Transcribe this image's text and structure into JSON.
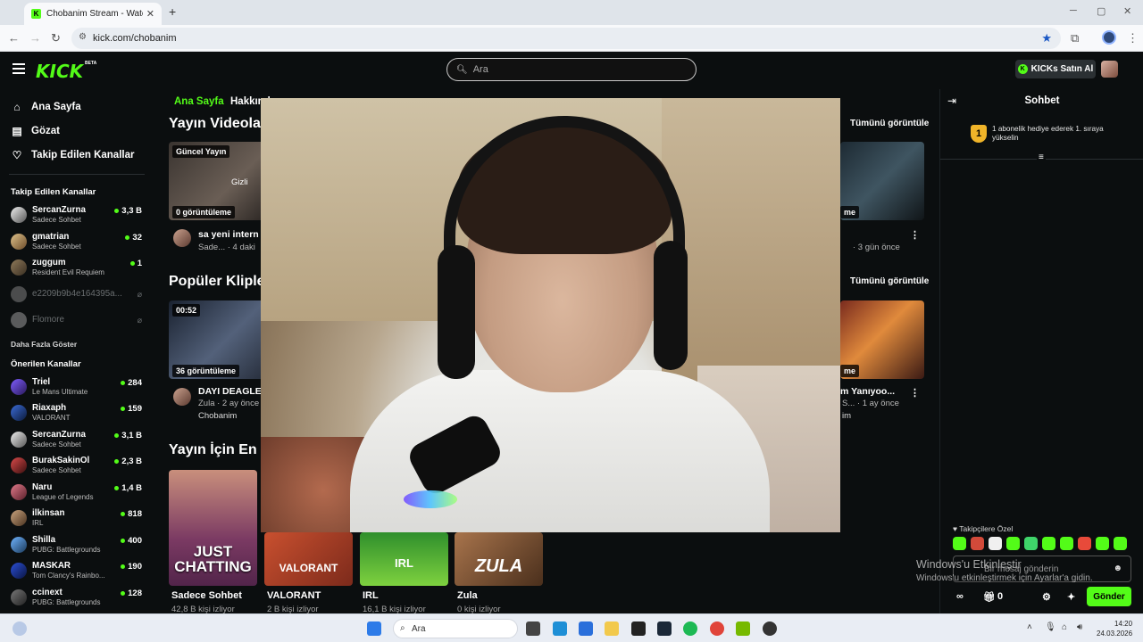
{
  "browser": {
    "tab_title": "Chobanim Stream - Watch Live",
    "tab_favicon": "K",
    "new_tab": "+",
    "url": "kick.com/chobanim"
  },
  "header": {
    "logo": "KICK",
    "beta": "BETA",
    "search_placeholder": "Ara",
    "kicks_button": "KICKs Satın Al",
    "accent_color": "#53fc18"
  },
  "sidebar": {
    "nav": [
      {
        "label": "Ana Sayfa",
        "icon": "home-icon"
      },
      {
        "label": "Gözat",
        "icon": "browse-icon"
      },
      {
        "label": "Takip Edilen Kanallar",
        "icon": "heart-icon"
      }
    ],
    "followed_title": "Takip Edilen Kanallar",
    "followed": [
      {
        "name": "SercanZurna",
        "category": "Sadece Sohbet",
        "viewers": "3,3 B"
      },
      {
        "name": "gmatrian",
        "category": "Sadece Sohbet",
        "viewers": "32"
      },
      {
        "name": "zuggum",
        "category": "Resident Evil Requiem",
        "viewers": "1"
      },
      {
        "name": "e2209b9b4e164395a...",
        "category": "",
        "viewers": ""
      },
      {
        "name": "Flomore",
        "category": "",
        "viewers": ""
      }
    ],
    "show_more": "Daha Fazla Göster",
    "recommended_title": "Önerilen Kanallar",
    "recommended": [
      {
        "name": "Triel",
        "category": "Le Mans Ultimate",
        "viewers": "284"
      },
      {
        "name": "Riaxaph",
        "category": "VALORANT",
        "viewers": "159"
      },
      {
        "name": "SercanZurna",
        "category": "Sadece Sohbet",
        "viewers": "3,1 B"
      },
      {
        "name": "BurakSakinOl",
        "category": "Sadece Sohbet",
        "viewers": "2,3 B"
      },
      {
        "name": "Naru",
        "category": "League of Legends",
        "viewers": "1,4 B"
      },
      {
        "name": "ilkinsan",
        "category": "IRL",
        "viewers": "818"
      },
      {
        "name": "Shilla",
        "category": "PUBG: Battlegrounds",
        "viewers": "400"
      },
      {
        "name": "MASKAR",
        "category": "Tom Clancy's Rainbo...",
        "viewers": "190"
      },
      {
        "name": "ccinext",
        "category": "PUBG: Battlegrounds",
        "viewers": "128"
      }
    ]
  },
  "main": {
    "tabs": [
      "Ana Sayfa",
      "Hakkında"
    ],
    "videos_title": "Yayın Videola",
    "see_all": "Tümünü görüntüle",
    "video1": {
      "badge": "Güncel Yayın",
      "hidden": "Gizli",
      "views": "0 görüntüleme",
      "title": "sa yeni intern",
      "meta": "Sade... · 4 daki"
    },
    "video_right": {
      "views": "me",
      "meta": "· 3 gün önce"
    },
    "clips_title": "Popüler Kliple",
    "clip1": {
      "duration": "00:52",
      "views": "36 görüntüleme",
      "title": "DAYI DEAGLE",
      "meta": "Zula · 2 ay önce",
      "channel": "Chobanim"
    },
    "clip_right": {
      "views": "me",
      "title": "m Yanıyoo...",
      "meta": "S... · 1 ay önce",
      "channel": "im"
    },
    "categories_title": "Yayın İçin En",
    "categories": [
      {
        "name": "Sadece Sohbet",
        "viewers": "42,8 B kişi izliyor",
        "art": "JUST CHATTING"
      },
      {
        "name": "VALORANT",
        "viewers": "2 B kişi izliyor",
        "art": "VALORANT"
      },
      {
        "name": "IRL",
        "viewers": "16,1 B kişi izliyor",
        "art": "IRL"
      },
      {
        "name": "Zula",
        "viewers": "0 kişi izliyor",
        "art": "ZULA"
      }
    ]
  },
  "chat": {
    "title": "Sohbet",
    "pinned_rank": "1",
    "pinned_text": "1 abonelik hediye ederek 1. sıraya yükselin",
    "emote_section": "Takipçilere Özel",
    "input_placeholder": "Bir mesaj gönderin",
    "gift_count": "0",
    "send_label": "Gönder"
  },
  "watermark": {
    "line1": "Windows'u Etkinleştir",
    "line2": "Windows'u etkinleştirmek için Ayarlar'a gidin."
  },
  "taskbar": {
    "search_placeholder": "Ara",
    "time": "14:20",
    "date": "24.03.2026"
  }
}
